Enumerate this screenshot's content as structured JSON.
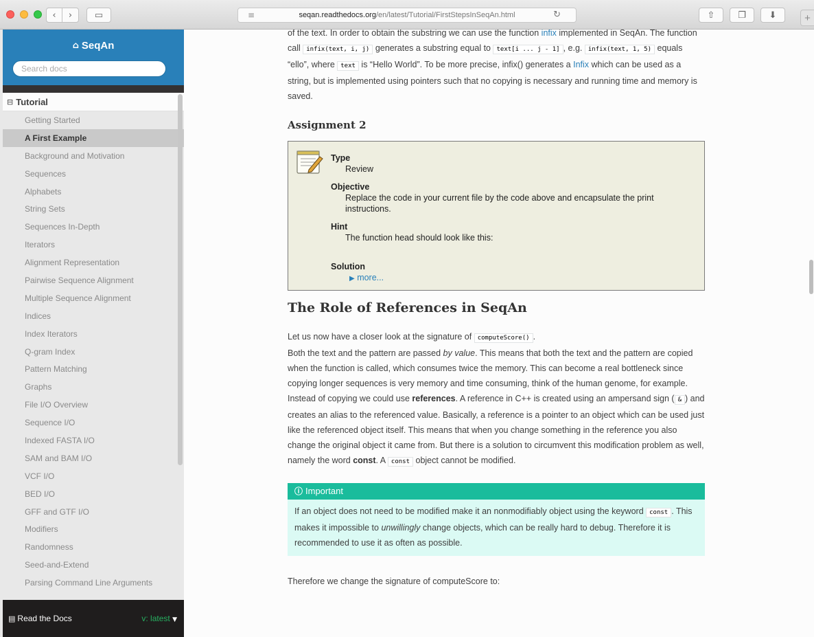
{
  "browser": {
    "url_domain": "seqan.readthedocs.org",
    "url_path": "/en/latest/Tutorial/FirstStepsInSeqAn.html"
  },
  "sidebar": {
    "brand": "SeqAn",
    "search_placeholder": "Search docs",
    "caption": "Tutorial",
    "items": [
      "Getting Started",
      "A First Example",
      "Background and Motivation",
      "Sequences",
      "Alphabets",
      "String Sets",
      "Sequences In-Depth",
      "Iterators",
      "Alignment Representation",
      "Pairwise Sequence Alignment",
      "Multiple Sequence Alignment",
      "Indices",
      "Index Iterators",
      "Q-gram Index",
      "Pattern Matching",
      "Graphs",
      "File I/O Overview",
      "Sequence I/O",
      "Indexed FASTA I/O",
      "SAM and BAM I/O",
      "VCF I/O",
      "BED I/O",
      "GFF and GTF I/O",
      "Modifiers",
      "Randomness",
      "Seed-and-Extend",
      "Parsing Command Line Arguments"
    ],
    "active_index": 1,
    "rtd_label": "Read the Docs",
    "version_label": "v: latest"
  },
  "content": {
    "intro": {
      "t1": "of the text. In order to obtain the substring we can use the function ",
      "link1": "infix",
      "t2": " implemented in SeqAn. The function call ",
      "code1": "infix(text, i, j)",
      "t3": " generates a substring equal to ",
      "code2": "text[i ... j - 1]",
      "t4": ", e.g. ",
      "code3": "infix(text, 1, 5)",
      "t5": " equals “ello”, where ",
      "code4": "text",
      "t6": " is “Hello World”. To be more precise, infix() generates a ",
      "link2": "Infix",
      "t7": " which can be used as a string, but is implemented using pointers such that no copying is necessary and running time and memory is saved."
    },
    "assignment_title": "Assignment 2",
    "assignment": {
      "type_label": "Type",
      "type_value": "Review",
      "objective_label": "Objective",
      "objective_value": "Replace the code in your current file by the code above and encapsulate the print instructions.",
      "hint_label": "Hint",
      "hint_value": "The function head should look like this:",
      "solution_label": "Solution",
      "more_label": "more..."
    },
    "section_title": "The Role of References in SeqAn",
    "p1": {
      "t1": "Let us now have a closer look at the signature of ",
      "code1": "computeScore()",
      "t2": "."
    },
    "p2": {
      "t1": "Both the text and the pattern are passed ",
      "em1": "by value",
      "t2": ". This means that both the text and the pattern are copied when the function is called, which consumes twice the memory. This can become a real bottleneck since copying longer sequences is very memory and time consuming, think of the human genome, for example."
    },
    "p3": {
      "t1": "Instead of copying we could use ",
      "b1": "references",
      "t2": ". A reference in C++ is created using an ampersand sign (",
      "code1": "&",
      "t3": ") and creates an alias to the referenced value. Basically, a reference is a pointer to an object which can be used just like the referenced object itself. This means that when you change something in the reference you also change the original object it came from. But there is a solution to circumvent this modification problem as well, namely the word ",
      "b2": "const",
      "t4": ". A ",
      "code2": "const",
      "t5": " object cannot be modified."
    },
    "important": {
      "title": "Important",
      "t1": "If an object does not need to be modified make it an nonmodifiably object using the keyword ",
      "code1": "const",
      "t2": ". This makes it impossible to ",
      "em1": "unwillingly",
      "t3": " change objects, which can be really hard to debug. Therefore it is recommended to use it as often as possible."
    },
    "tail": "Therefore we change the signature of computeScore to:"
  }
}
